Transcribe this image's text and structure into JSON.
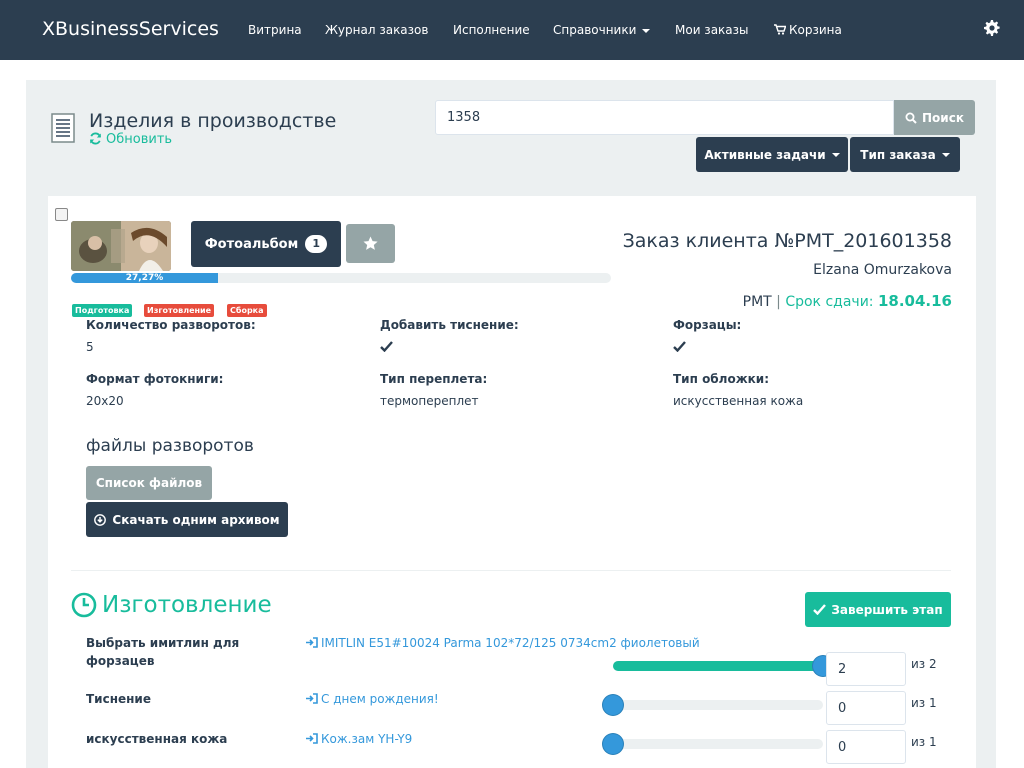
{
  "navbar": {
    "brand": "XBusinessServices",
    "items": [
      {
        "label": "Витрина"
      },
      {
        "label": "Журнал заказов"
      },
      {
        "label": "Исполнение"
      },
      {
        "label": "Справочники"
      },
      {
        "label": "Мои заказы"
      },
      {
        "label": "Корзина"
      }
    ]
  },
  "header": {
    "title": "Изделия в производстве",
    "refresh_label": "Обновить",
    "search_value": "1358",
    "search_button": "Поиск",
    "active_tasks_label": "Активные задачи",
    "order_type_label": "Тип заказа"
  },
  "order": {
    "product_button": "Фотоальбом",
    "product_count": "1",
    "progress_text": "27,27%",
    "progress_fraction": 0.2727,
    "stage_tags": [
      "Подготовка",
      "Изготовление",
      "Сборка"
    ],
    "title": "Заказ клиента №PMT_201601358",
    "client": "Elzana Omurzakova",
    "code": "PMT",
    "separator": "|",
    "due_label": "Срок сдачи:",
    "due_date": "18.04.16",
    "properties": [
      {
        "label": "Количество разворотов:",
        "value": "5"
      },
      {
        "label": "Добавить тиснение:",
        "value": ""
      },
      {
        "label": "Форзацы:",
        "value": ""
      },
      {
        "label": "Формат фотокниги:",
        "value": "20x20"
      },
      {
        "label": "Тип переплета:",
        "value": "термопереплет"
      },
      {
        "label": "Тип обложки:",
        "value": "искусственная кожа"
      }
    ],
    "files_heading": "файлы разворотов",
    "files_list_button": "Список файлов",
    "download_button": "Скачать одним архивом"
  },
  "stage": {
    "title": "Изготовление",
    "finish_button": "Завершить этап",
    "materials": [
      {
        "label": "Выбрать имитлин для форзацев",
        "item": "IMITLIN E51#10024 Parma 102*72/125 0734cm2 фиолетовый",
        "qty": "2",
        "of": "из 2",
        "fraction": 1.0
      },
      {
        "label": "Тиснение",
        "item": "С днем рождения!",
        "qty": "0",
        "of": "из 1",
        "fraction": 0.0
      },
      {
        "label": "искусственная кожа",
        "item": "Кож.зам YH-Y9",
        "qty": "0",
        "of": "из 1",
        "fraction": 0.0
      }
    ]
  },
  "colors": {
    "navbar": "#2c3e50",
    "accent_green": "#18bc9c",
    "accent_blue": "#3498db",
    "danger": "#e74c3c",
    "muted": "#95a5a6"
  }
}
